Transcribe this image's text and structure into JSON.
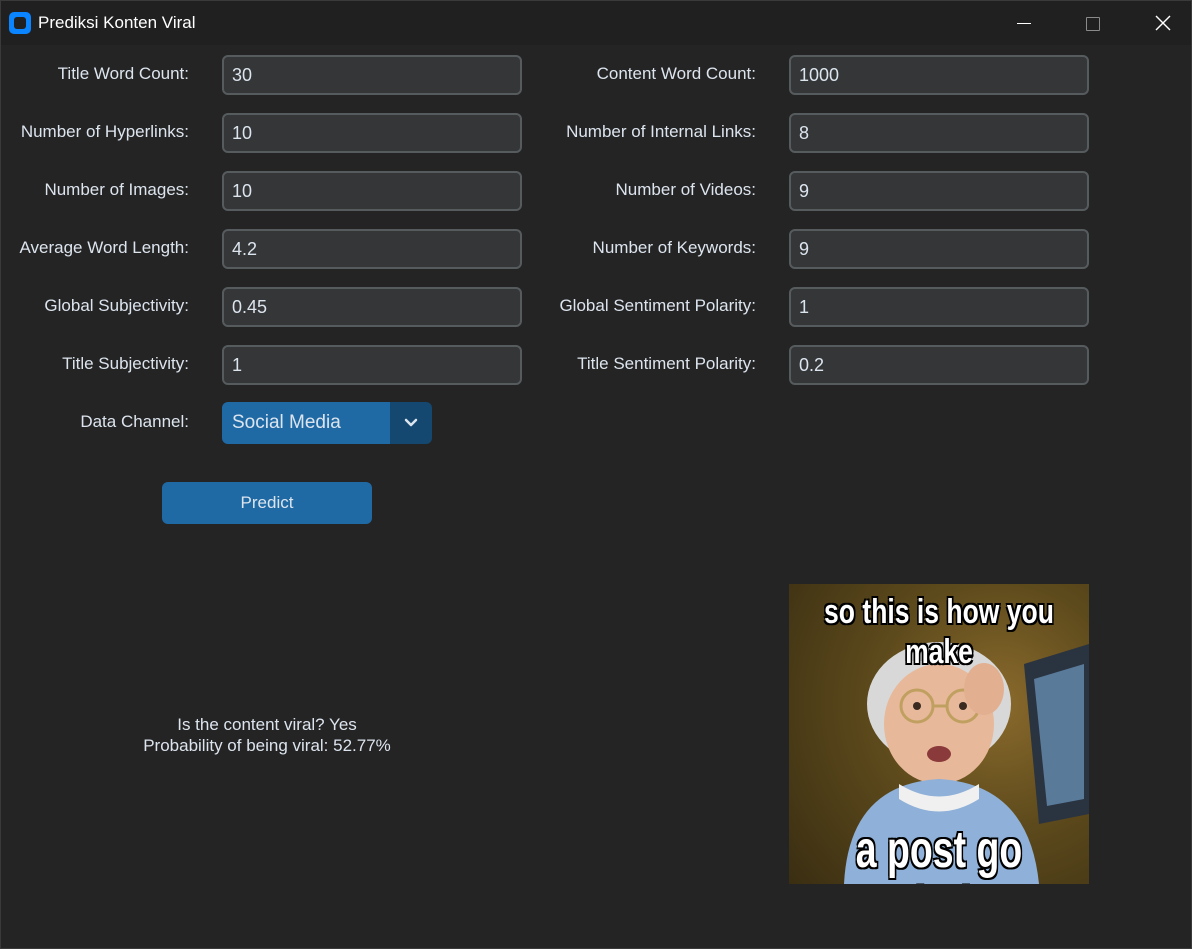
{
  "window": {
    "title": "Prediksi Konten Viral"
  },
  "form": {
    "left": [
      {
        "label": "Title Word Count:",
        "value": "30"
      },
      {
        "label": "Number of Hyperlinks:",
        "value": "10"
      },
      {
        "label": "Number of Images:",
        "value": "10"
      },
      {
        "label": "Average Word Length:",
        "value": "4.2"
      },
      {
        "label": "Global Subjectivity:",
        "value": "0.45"
      },
      {
        "label": "Title Subjectivity:",
        "value": "1"
      }
    ],
    "right": [
      {
        "label": "Content Word Count:",
        "value": "1000"
      },
      {
        "label": "Number of Internal Links:",
        "value": "8"
      },
      {
        "label": "Number of Videos:",
        "value": "9"
      },
      {
        "label": "Number of Keywords:",
        "value": "9"
      },
      {
        "label": "Global Sentiment Polarity:",
        "value": "1"
      },
      {
        "label": "Title Sentiment Polarity:",
        "value": "0.2"
      }
    ],
    "data_channel": {
      "label": "Data Channel:",
      "selected": "Social Media"
    }
  },
  "predict_button": "Predict",
  "result": {
    "line1": "Is the content viral? Yes",
    "line2": "Probability of being viral: 52.77%"
  },
  "meme": {
    "top_text": "so this is how you make",
    "bottom_text": "a post go viral!"
  },
  "colors": {
    "accent": "#1f6aa5",
    "accent_dark": "#144870",
    "field_bg": "#343638",
    "field_border": "#565b5e",
    "window_bg": "#242424"
  }
}
